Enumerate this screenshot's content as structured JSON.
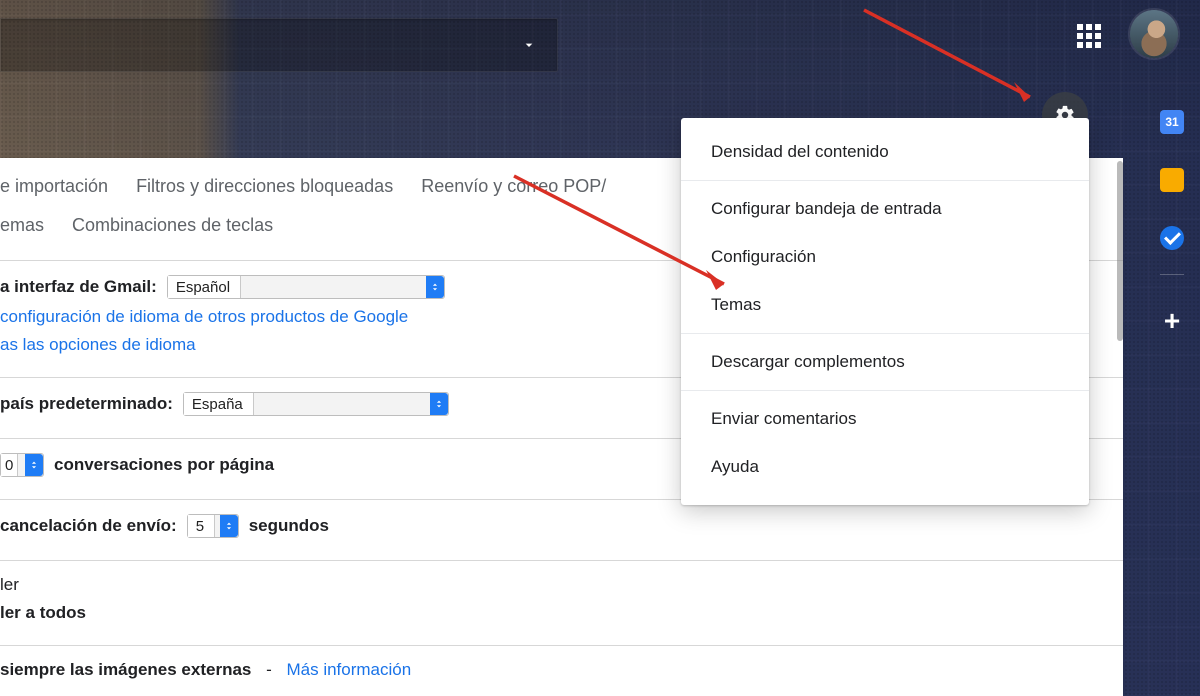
{
  "search": {
    "placeholder": ""
  },
  "topnav": {
    "apps": "Apps",
    "account": "Account"
  },
  "gear": {
    "tooltip": "Settings"
  },
  "gearMenu": {
    "density": "Densidad del contenido",
    "inbox": "Configurar bandeja de entrada",
    "settings": "Configuración",
    "themes": "Temas",
    "addons": "Descargar complementos",
    "feedback": "Enviar comentarios",
    "help": "Ayuda"
  },
  "tabs1": {
    "import": "e importación",
    "filters": "Filtros y direcciones bloqueadas",
    "forward": "Reenvío y correo POP/"
  },
  "tabs2": {
    "themes": "emas",
    "shortcuts": "Combinaciones de teclas"
  },
  "settings": {
    "langLabel": "a interfaz de Gmail:",
    "language": "Español",
    "langLinkA": "configuración de idioma de otros productos de Google",
    "langLinkB": "as las opciones de idioma",
    "countryLabel": "país predeterminado:",
    "country": "España",
    "pageSizeValue": "0",
    "pageSizeLabel": "conversaciones por página",
    "undoLabel": "cancelación de envío:",
    "undoValue": "5",
    "undoUnit": "segundos",
    "replyA": "ler",
    "replyB": "ler a todos",
    "imagesLabel": "siempre las imágenes externas",
    "imagesLink": "Más información"
  },
  "sidepanel": {
    "calendarDay": "31",
    "keep": "",
    "tasks": "",
    "add": "+"
  }
}
